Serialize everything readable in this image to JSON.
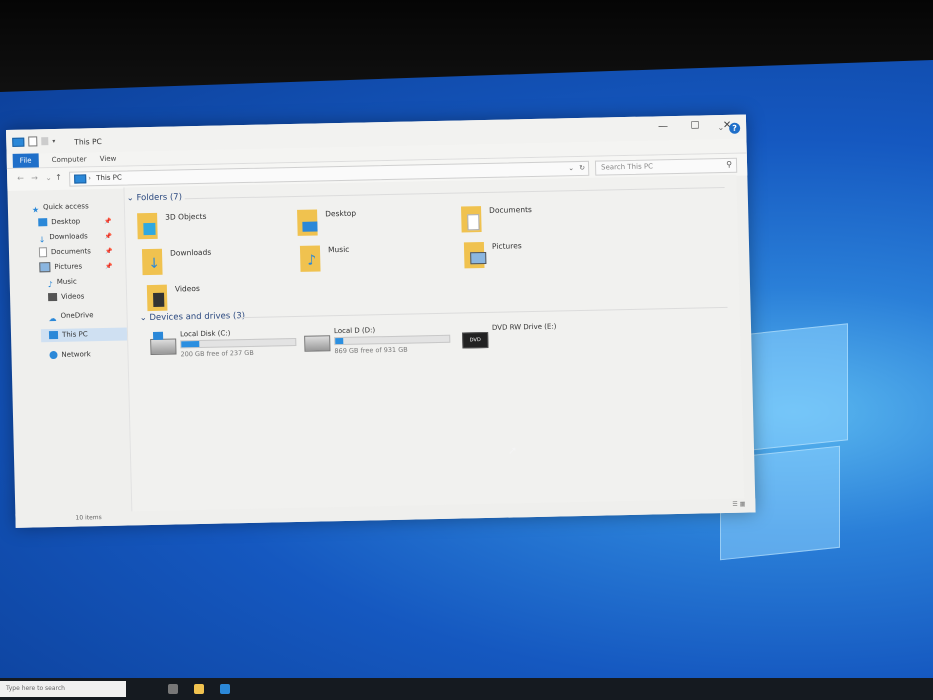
{
  "window": {
    "title": "This PC",
    "controls": {
      "minimize": "—",
      "maximize": "☐",
      "close": "✕"
    }
  },
  "ribbon": {
    "tabs": [
      "File",
      "Computer",
      "View"
    ],
    "help": "?"
  },
  "address_bar": {
    "location": "This PC",
    "search_placeholder": "Search This PC"
  },
  "sidebar": {
    "items": [
      {
        "label": "Quick access",
        "icon": "star-icon"
      },
      {
        "label": "Desktop",
        "icon": "desktop-icon",
        "pinned": true
      },
      {
        "label": "Downloads",
        "icon": "download-icon",
        "pinned": true
      },
      {
        "label": "Documents",
        "icon": "documents-icon",
        "pinned": true
      },
      {
        "label": "Pictures",
        "icon": "pictures-icon",
        "pinned": true
      },
      {
        "label": "Music",
        "icon": "music-icon"
      },
      {
        "label": "Videos",
        "icon": "videos-icon"
      },
      {
        "label": "OneDrive",
        "icon": "cloud-icon"
      },
      {
        "label": "This PC",
        "icon": "computer-icon",
        "selected": true
      },
      {
        "label": "Network",
        "icon": "network-icon"
      }
    ]
  },
  "folders": {
    "header": "Folders (7)",
    "items": [
      "3D Objects",
      "Desktop",
      "Documents",
      "Downloads",
      "Music",
      "Pictures",
      "Videos"
    ]
  },
  "drives": {
    "header": "Devices and drives (3)",
    "items": [
      {
        "name": "Local Disk (C:)",
        "free": "200 GB free of 237 GB",
        "used_fraction": 0.16
      },
      {
        "name": "Local D (D:)",
        "free": "869 GB free of 931 GB",
        "used_fraction": 0.07
      },
      {
        "name": "DVD RW Drive (E:)"
      }
    ]
  },
  "status": {
    "item_count": "10 items"
  },
  "taskbar": {
    "search_placeholder": "Type here to search"
  },
  "colors": {
    "accent": "#1f6fc9",
    "folder": "#f0c24f",
    "desktop": "#1558c0"
  }
}
